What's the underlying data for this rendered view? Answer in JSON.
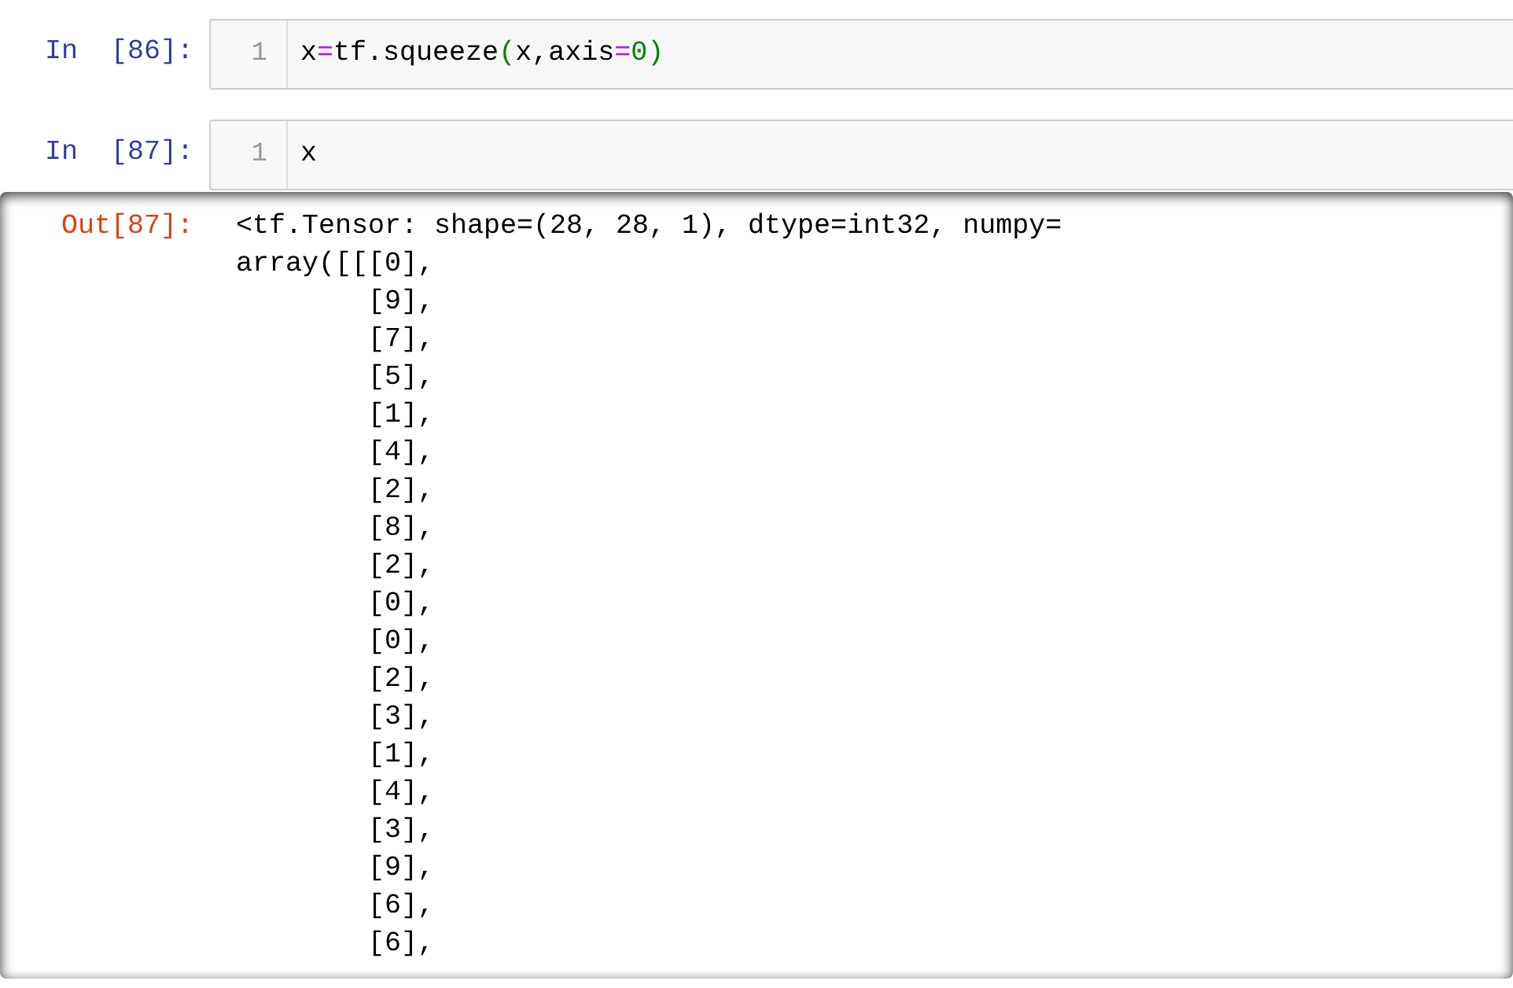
{
  "cells": [
    {
      "prompt": "In  [86]:",
      "line_number": "1",
      "code": [
        {
          "kind": "name",
          "text": "x"
        },
        {
          "kind": "operator",
          "text": "="
        },
        {
          "kind": "name",
          "text": "tf.squeeze"
        },
        {
          "kind": "paren",
          "text": "("
        },
        {
          "kind": "name",
          "text": "x,axis"
        },
        {
          "kind": "operator",
          "text": "="
        },
        {
          "kind": "number",
          "text": "0"
        },
        {
          "kind": "paren",
          "text": ")"
        }
      ]
    },
    {
      "prompt": "In  [87]:",
      "line_number": "1",
      "code": [
        {
          "kind": "name",
          "text": "x"
        }
      ]
    }
  ],
  "output": {
    "prompt": "Out[87]:",
    "lines": [
      "<tf.Tensor: shape=(28, 28, 1), dtype=int32, numpy=",
      "array([[[0],",
      "        [9],",
      "        [7],",
      "        [5],",
      "        [1],",
      "        [4],",
      "        [2],",
      "        [8],",
      "        [2],",
      "        [0],",
      "        [0],",
      "        [2],",
      "        [3],",
      "        [1],",
      "        [4],",
      "        [3],",
      "        [9],",
      "        [6],",
      "        [6],"
    ]
  }
}
